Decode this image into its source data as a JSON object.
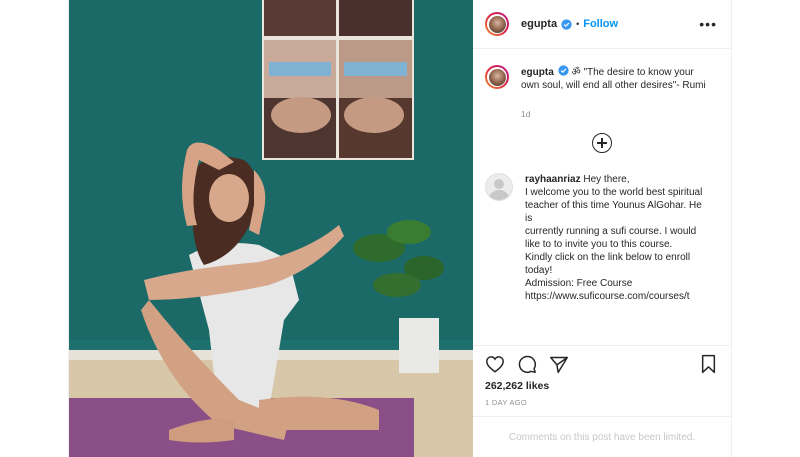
{
  "post": {
    "username": "egupta",
    "follow_label": "Follow",
    "dot": "•",
    "more_label": "•••",
    "caption": {
      "username": "egupta",
      "text": " ॐ \"The desire to know your own soul, will end all other desires\"- Rumi",
      "time": "1d"
    },
    "comment": {
      "username": "rayhaanriaz",
      "lines": [
        " Hey there,",
        "I welcome you to the world best spiritual teacher of this time Younus AlGohar. He is",
        "currently running a sufi course. I would like to to invite you to this course.",
        "Kindly click on the link below to enroll today!",
        "Admission: Free Course",
        "https://www.suficourse.com/courses/t"
      ]
    },
    "likes": "262,262 likes",
    "date": "1 DAY AGO",
    "comments_limited": "Comments on this post have been limited."
  },
  "icons": {
    "verified": "verified-badge-icon",
    "like": "heart-icon",
    "comment": "comment-bubble-icon",
    "share": "paper-plane-icon",
    "save": "bookmark-icon",
    "load_more": "circle-plus-icon"
  },
  "colors": {
    "accent": "#0095f6",
    "wall": "#1b6f6c",
    "mat": "#8a4f86",
    "text_muted": "#8e8e8e"
  }
}
